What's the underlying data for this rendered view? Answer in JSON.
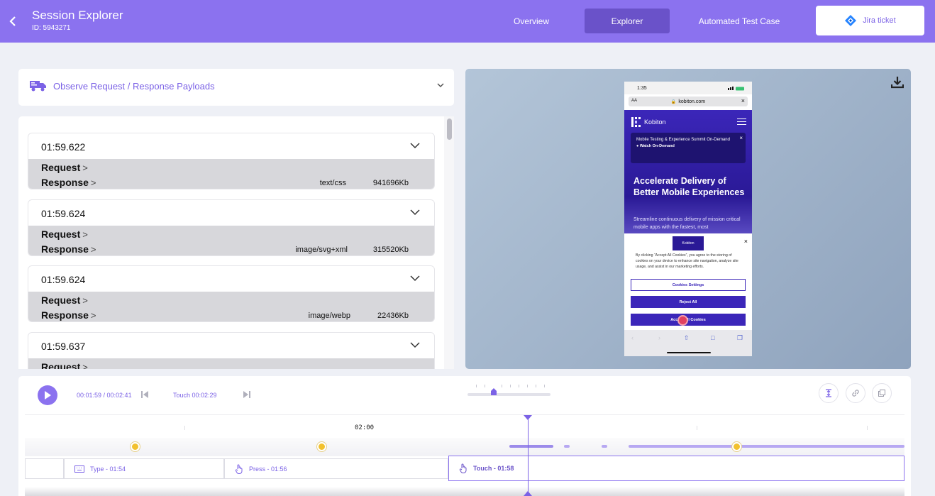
{
  "header": {
    "title": "Session Explorer",
    "session_id": "ID: 5943271",
    "tabs": [
      {
        "label": "Overview",
        "active": false
      },
      {
        "label": "Explorer",
        "active": true
      },
      {
        "label": "Automated Test Case",
        "active": false
      }
    ],
    "jira_label": "Jira ticket"
  },
  "payloads": {
    "title": "Observe Request / Response Payloads",
    "request_label": "Request",
    "response_label": "Response",
    "entries": [
      {
        "time": "01:59.622",
        "type": "text/css",
        "size": "941696Kb"
      },
      {
        "time": "01:59.624",
        "type": "image/svg+xml",
        "size": "315520Kb"
      },
      {
        "time": "01:59.624",
        "type": "image/webp",
        "size": "22436Kb"
      },
      {
        "time": "01:59.637",
        "type": "",
        "size": ""
      }
    ]
  },
  "phone": {
    "time": "1:35",
    "url": "kobiton.com",
    "aa": "AA",
    "brand": "Kobiton",
    "banner_text": "Mobile Testing & Experience Summit On-Demand",
    "banner_link": "Watch On-Demand",
    "headline": "Accelerate Delivery of Better Mobile Experiences",
    "subtext": "Streamline continuous delivery of mission critical mobile apps with the fastest, most",
    "cookie_logo": "Kobiton",
    "cookie_text": "By clicking “Accept All Cookies”, you agree to the storing of cookies on your device to enhance site navigation, analyze site usage, and assist in our marketing efforts.",
    "btn_settings": "Cookies Settings",
    "btn_reject": "Reject All",
    "btn_accept": "Accept All Cookies"
  },
  "player": {
    "time_display": "00:01:59 / 00:02:41",
    "touch_label": "Touch 00:02:29",
    "slider_level": 0.3
  },
  "timeline": {
    "label": "02:00",
    "events": [
      {
        "label": "Type - 01:54",
        "icon": "keyboard-icon",
        "selected": false
      },
      {
        "label": "Press - 01:56",
        "icon": "hand-icon",
        "selected": false
      },
      {
        "label": "Touch - 01:58",
        "icon": "hand-icon",
        "selected": true
      }
    ]
  },
  "colors": {
    "primary": "#8b72ef",
    "active_tab": "#6a52c9",
    "marker": "#f2c12e",
    "phone_brand": "#3b26b9"
  }
}
